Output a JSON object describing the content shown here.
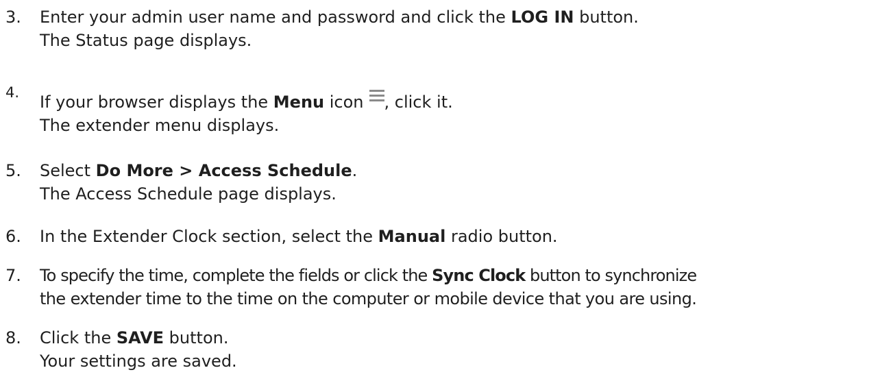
{
  "steps": [
    {
      "number": "3.",
      "pre": "Enter your admin user name and password and click the ",
      "bold": "LOG IN",
      "post": " button.",
      "result": "The Status page displays."
    },
    {
      "number": "4.",
      "pre": "If your browser displays the ",
      "bold": "Menu",
      "mid": " icon",
      "post": ", click it.",
      "icon": "menu-hamburger-icon",
      "result": "The extender menu displays."
    },
    {
      "number": "5.",
      "pre": "Select ",
      "bold": "Do More > Access Schedule",
      "post": ".",
      "result": "The Access Schedule page displays."
    },
    {
      "number": "6.",
      "pre": "In the Extender Clock section, select the ",
      "bold": "Manual",
      "post": " radio button."
    },
    {
      "number": "7.",
      "pre": "To specify the time, complete the fields or click the ",
      "bold": "Sync Clock",
      "post": " button to synchronize",
      "continuation": "the extender time to the time on the computer or mobile device that you are using."
    },
    {
      "number": "8.",
      "pre": "Click the ",
      "bold": "SAVE",
      "post": " button.",
      "result": "Your settings are saved."
    }
  ]
}
